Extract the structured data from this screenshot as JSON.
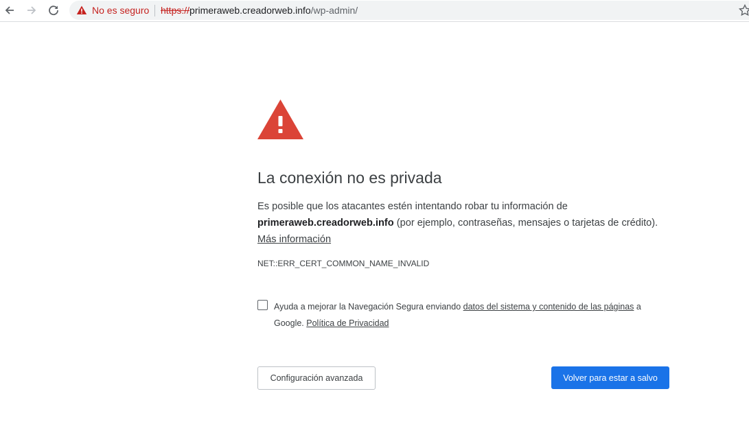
{
  "browser": {
    "security_label": "No es seguro",
    "url": {
      "scheme": "https://",
      "host": "primeraweb.creadorweb.info",
      "path": "/wp-admin/"
    },
    "colors": {
      "insecure_red": "#c5221f",
      "omnibox_bg": "#f1f3f4"
    }
  },
  "interstitial": {
    "heading": "La conexión no es privada",
    "description_before": "Es posible que los atacantes estén intentando robar tu información de ",
    "domain": "primeraweb.creadorweb.info",
    "description_after": " (por ejemplo, contraseñas, mensajes o tarjetas de crédito). ",
    "more_info_link": "Más información",
    "error_code": "NET::ERR_CERT_COMMON_NAME_INVALID",
    "optin": {
      "text_before": "Ayuda a mejorar la Navegación Segura enviando ",
      "link_data": "datos del sistema y contenido de las páginas",
      "text_middle": " a Google. ",
      "link_privacy": "Política de Privacidad",
      "checked": false
    },
    "buttons": {
      "advanced": "Configuración avanzada",
      "back_to_safety": "Volver para estar a salvo"
    },
    "colors": {
      "warning_red": "#db4437",
      "primary_blue": "#1a73e8"
    },
    "icons": [
      "warning-triangle-icon"
    ]
  }
}
